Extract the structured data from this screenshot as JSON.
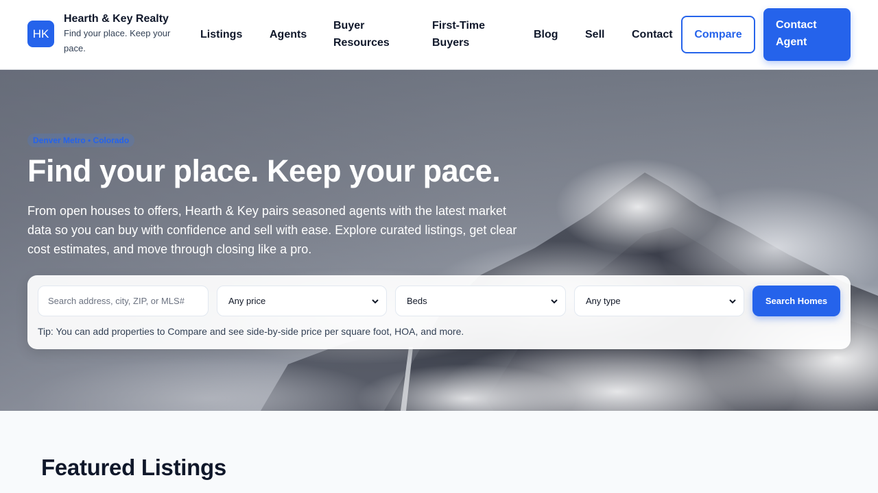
{
  "brand": {
    "logo_text": "HK",
    "name": "Hearth & Key Realty",
    "tagline": "Find your place. Keep your pace."
  },
  "nav": {
    "items": [
      {
        "label": "Listings"
      },
      {
        "label": "Agents"
      },
      {
        "label": "Buyer Resources"
      },
      {
        "label": "First-Time Buyers"
      },
      {
        "label": "Blog"
      },
      {
        "label": "Sell"
      },
      {
        "label": "Contact"
      }
    ],
    "compare_label": "Compare",
    "contact_agent_label": "Contact Agent"
  },
  "hero": {
    "eyebrow": "Denver Metro • Colorado",
    "title": "Find your place. Keep your pace.",
    "description": "From open houses to offers, Hearth & Key pairs seasoned agents with the latest market data so you can buy with confidence and sell with ease. Explore curated listings, get clear cost estimates, and move through closing like a pro."
  },
  "search": {
    "placeholder": "Search address, city, ZIP, or MLS#",
    "price_selected": "Any price",
    "beds_selected": "Beds",
    "type_selected": "Any type",
    "button_label": "Search Homes",
    "tip": "Tip: You can add properties to Compare and see side-by-side price per square foot, HOA, and more."
  },
  "featured": {
    "title": "Featured Listings"
  },
  "colors": {
    "accent": "#2563eb",
    "text": "#0f172a",
    "page_bg": "#f8fafc"
  }
}
